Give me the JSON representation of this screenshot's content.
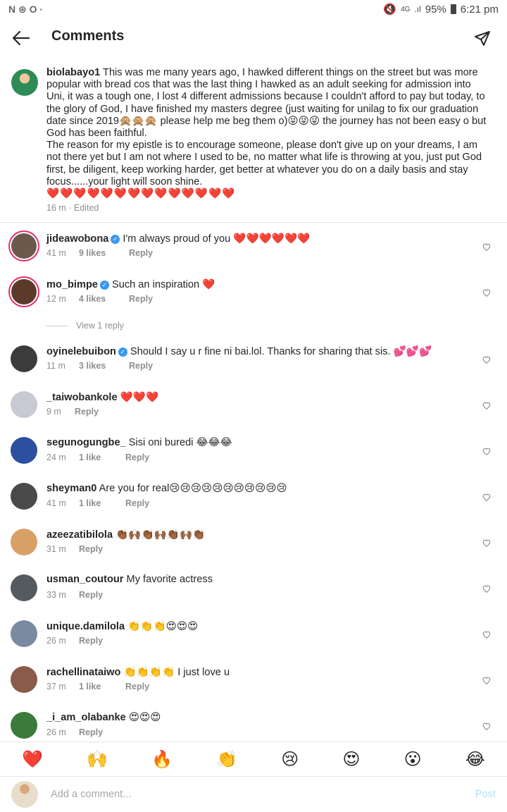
{
  "status_bar": {
    "left_icons": "N ⊛ O ·",
    "network": "4G",
    "battery": "95%",
    "time": "6:21 pm"
  },
  "header": {
    "title": "Comments"
  },
  "caption": {
    "username": "biolabayo1",
    "text_p1": "This was me many years ago, I hawked different things on the street but was more popular with bread cos that was the last thing I hawked as an adult seeking for admission into Uni, it was a tough one, I lost 4 different admissions because I couldn't afford to pay but today, to the glory of God, I have finished my masters degree (just waiting for unilag to fix our graduation date since 2019🙊🙊🙊 please help me beg them o)😜😜😜 the journey has not been easy o but God has been faithful.",
    "text_p2": "The reason for my epistle is to encourage someone, please don't give up on your dreams, I am not there yet but I am not where I used to be, no matter what life is throwing at you, just put God first, be diligent, keep working harder, get better at whatever you do on a daily basis and stay focus......your light will soon shine.",
    "hearts": "❤️❤️❤️❤️❤️❤️❤️❤️❤️❤️❤️❤️❤️❤️",
    "meta": "16 m · Edited"
  },
  "comments": [
    {
      "username": "jideawobona",
      "verified": true,
      "text": "I'm always proud of you ❤️❤️❤️❤️❤️❤️",
      "time": "41 m",
      "likes": "9 likes",
      "reply": "Reply"
    },
    {
      "username": "mo_bimpe",
      "verified": true,
      "text": "Such an inspiration ❤️",
      "time": "12 m",
      "likes": "4 likes",
      "reply": "Reply"
    },
    {
      "username": "oyinelebuibon",
      "verified": true,
      "text": "Should I say u r fine ni bai.lol. Thanks for sharing that sis. 💕💕💕",
      "time": "11 m",
      "likes": "3 likes",
      "reply": "Reply"
    },
    {
      "username": "_taiwobankole",
      "verified": false,
      "text": "❤️❤️❤️",
      "time": "9 m",
      "likes": "",
      "reply": "Reply"
    },
    {
      "username": "segunogungbe_",
      "verified": false,
      "text": "Sisi oni buredi 😂😂😂",
      "time": "24 m",
      "likes": "1 like",
      "reply": "Reply"
    },
    {
      "username": "sheyman0",
      "verified": false,
      "text": "Are you for real😢😢😢😢😢😢😢😢😢😢😢",
      "time": "41 m",
      "likes": "1 like",
      "reply": "Reply"
    },
    {
      "username": "azeezatibilola",
      "verified": false,
      "text": "👏🏾🙌🏾👏🏾🙌🏾👏🏾🙌🏾👏🏾",
      "time": "31 m",
      "likes": "",
      "reply": "Reply"
    },
    {
      "username": "usman_coutour",
      "verified": false,
      "text": "My favorite actress",
      "time": "33 m",
      "likes": "",
      "reply": "Reply"
    },
    {
      "username": "unique.damilola",
      "verified": false,
      "text": "👏👏👏😍😍😍",
      "time": "26 m",
      "likes": "",
      "reply": "Reply"
    },
    {
      "username": "rachellinataiwo",
      "verified": false,
      "text": "👏👏👏👏 I just love u",
      "time": "37 m",
      "likes": "1 like",
      "reply": "Reply"
    },
    {
      "username": "_i_am_olabanke",
      "verified": false,
      "text": "😍😍😍",
      "time": "26 m",
      "likes": "",
      "reply": "Reply"
    }
  ],
  "view_replies": "View 1 reply",
  "emoji_bar": [
    "❤️",
    "🙌",
    "🔥",
    "👏",
    "😢",
    "😍",
    "😮",
    "😂"
  ],
  "comment_input": {
    "placeholder": "Add a comment...",
    "post_label": "Post"
  },
  "colors": {
    "verified": "#3897f0",
    "post_disabled": "#b2dffc",
    "heart": "#e0245e"
  }
}
